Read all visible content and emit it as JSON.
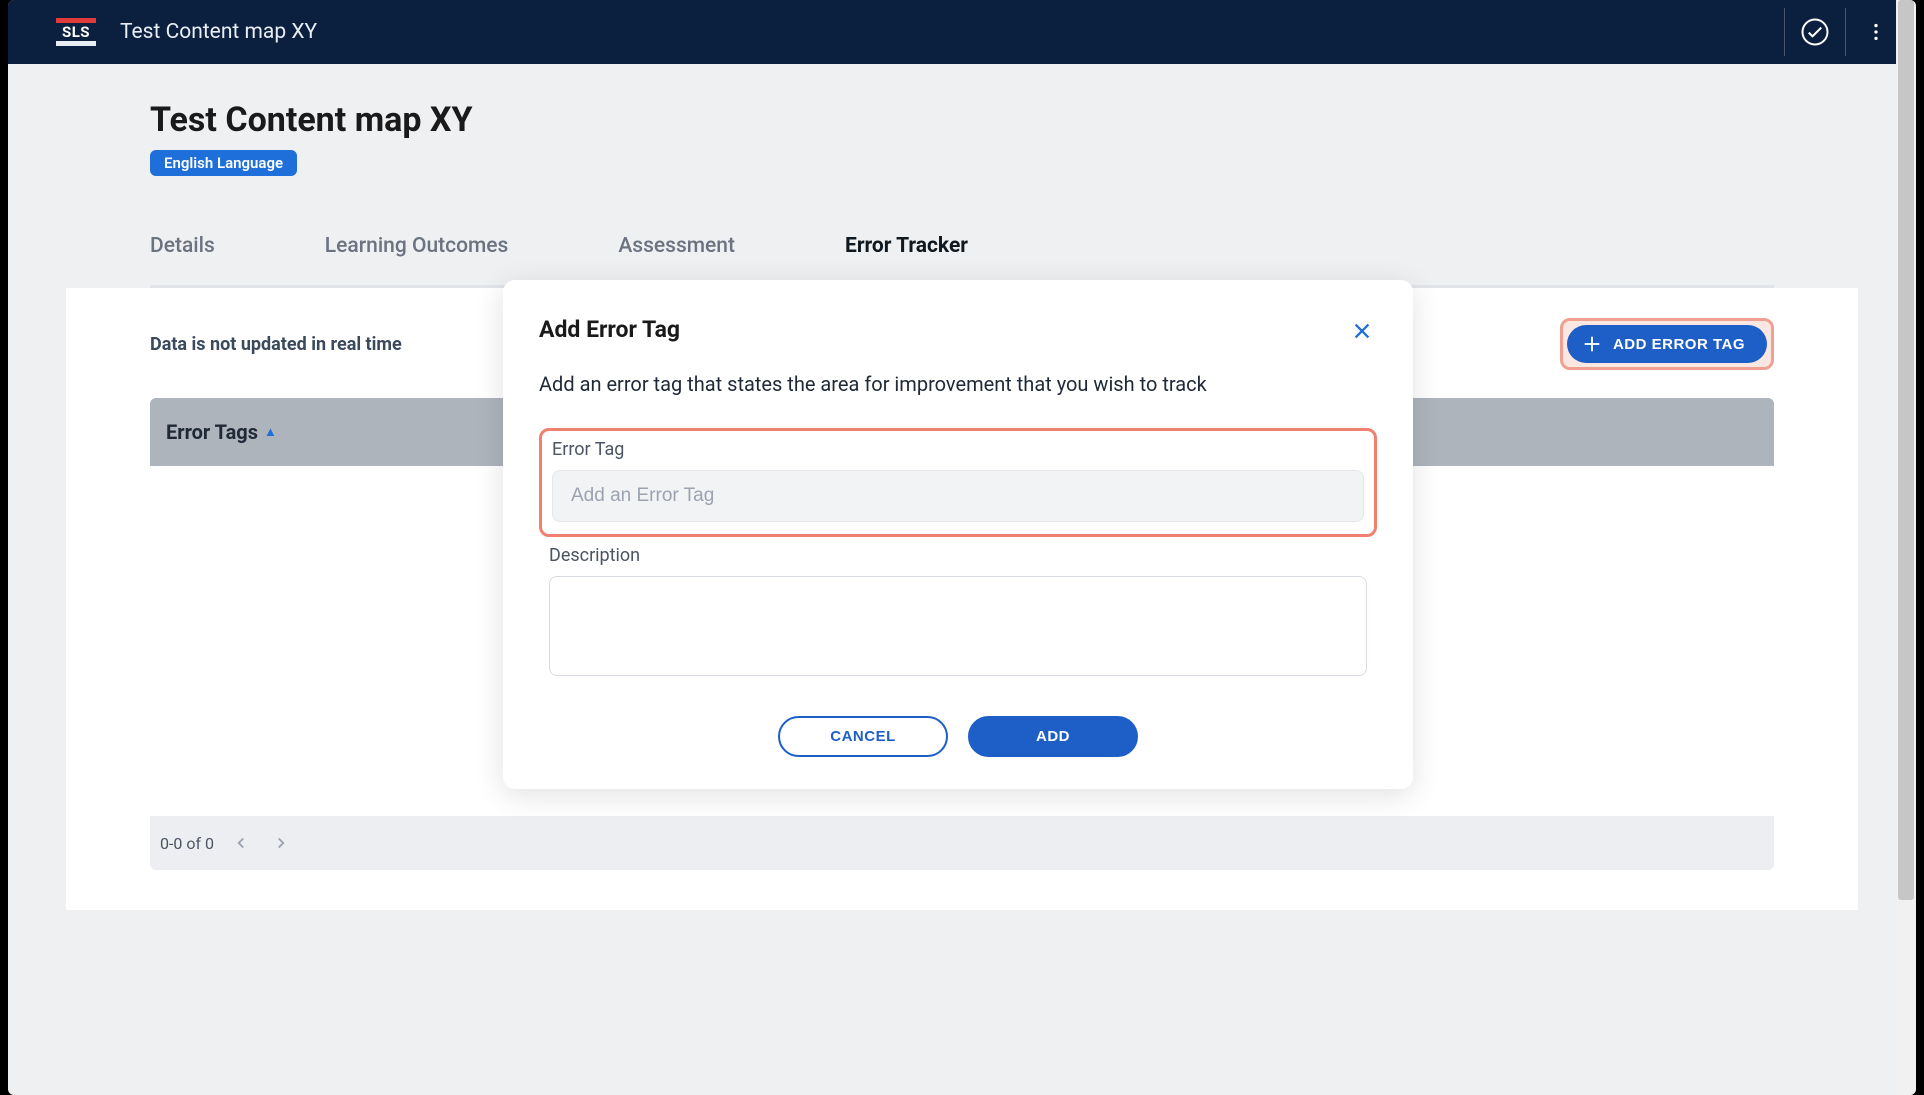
{
  "topbar": {
    "logo_text": "SLS",
    "title": "Test Content map XY"
  },
  "page": {
    "title": "Test Content map XY",
    "subject_badge": "English Language"
  },
  "tabs": [
    {
      "label": "Details",
      "active": false
    },
    {
      "label": "Learning Outcomes",
      "active": false
    },
    {
      "label": "Assessment",
      "active": false
    },
    {
      "label": "Error Tracker",
      "active": true
    }
  ],
  "panel": {
    "info_text": "Data is not updated in real time",
    "add_button_label": "ADD ERROR TAG",
    "table": {
      "column_header": "Error Tags",
      "pagination_text": "0-0 of 0"
    }
  },
  "modal": {
    "title": "Add Error Tag",
    "subtitle": "Add an error tag that states the area for improvement that you wish to track",
    "field_error_tag_label": "Error Tag",
    "field_error_tag_placeholder": "Add an Error Tag",
    "field_description_label": "Description",
    "cancel_label": "CANCEL",
    "add_label": "ADD"
  }
}
